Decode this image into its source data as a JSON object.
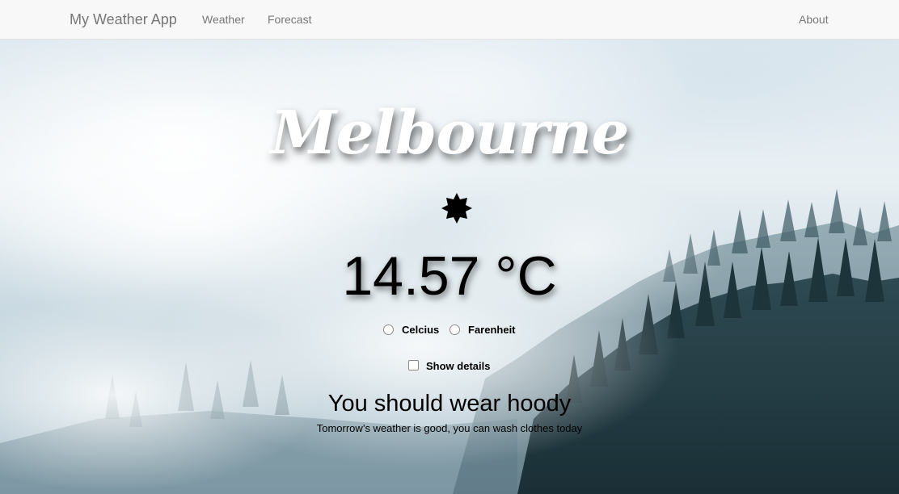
{
  "navbar": {
    "brand": "My Weather App",
    "links": [
      "Weather",
      "Forecast"
    ],
    "about": "About"
  },
  "weather": {
    "city": "Melbourne",
    "icon": "weather-condition-icon",
    "temperature": "14.57 °C",
    "units": {
      "celsius_label": "Celcius",
      "fahrenheit_label": "Farenheit"
    },
    "details_label": "Show details",
    "advice": "You should wear hoody",
    "tomorrow_note": "Tomorrow’s weather is good, you can wash clothes today"
  },
  "colors": {
    "navbar_bg": "#f8f8f8",
    "nav_text": "#777777",
    "city_text": "#ffffff"
  }
}
